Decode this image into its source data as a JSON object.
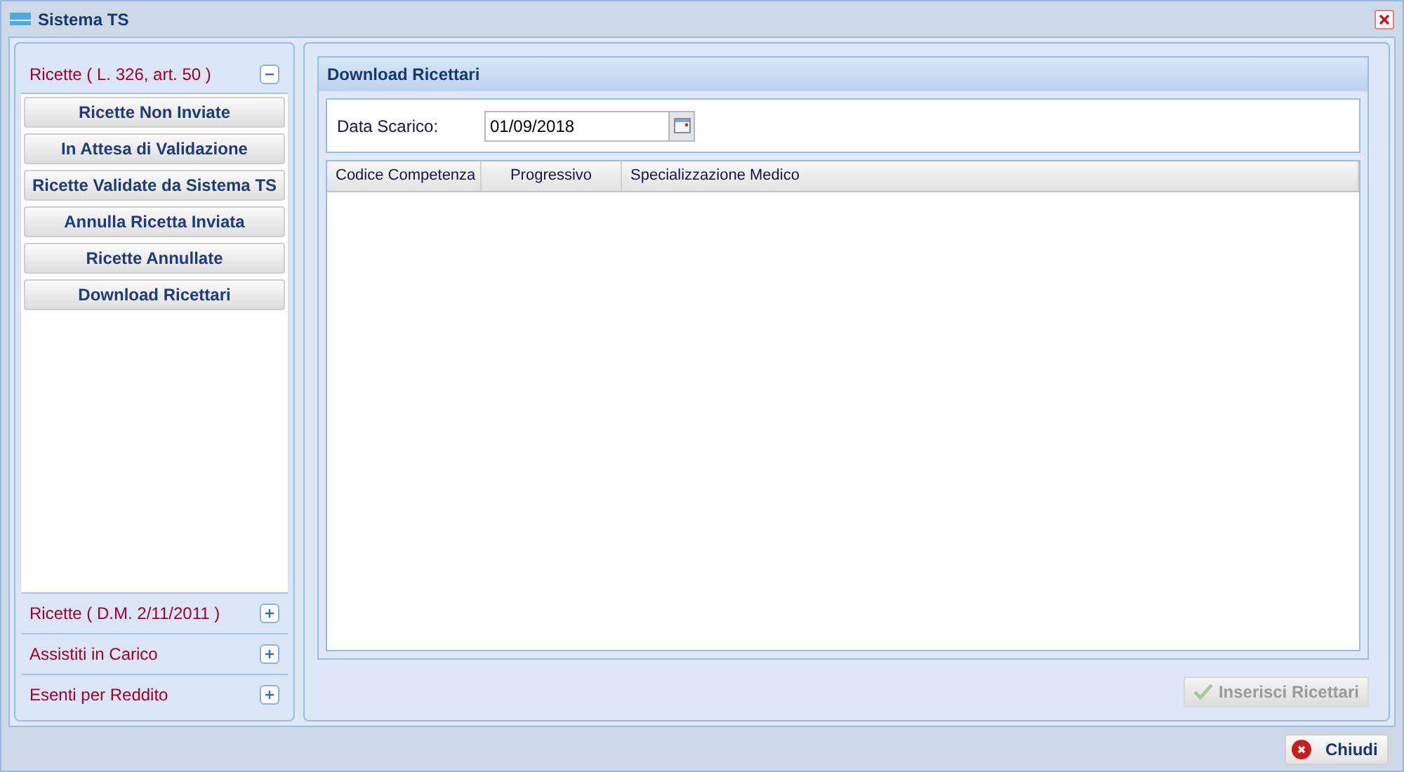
{
  "window": {
    "title": "Sistema TS"
  },
  "sidebar": {
    "sections": [
      {
        "title": "Ricette ( L. 326, art. 50 )",
        "expanded": true,
        "items": [
          "Ricette Non Inviate",
          "In Attesa di Validazione",
          "Ricette Validate da Sistema TS",
          "Annulla Ricetta Inviata",
          "Ricette Annullate",
          "Download Ricettari"
        ]
      },
      {
        "title": "Ricette ( D.M. 2/11/2011 )",
        "expanded": false
      },
      {
        "title": "Assistiti in Carico",
        "expanded": false
      },
      {
        "title": "Esenti per Reddito",
        "expanded": false
      }
    ]
  },
  "panel": {
    "title": "Download Ricettari",
    "field": {
      "label": "Data Scarico:",
      "value": "01/09/2018"
    },
    "table": {
      "columns": [
        "Codice Competenza",
        "Progressivo",
        "Specializzazione Medico"
      ]
    },
    "action": {
      "label": "Inserisci Ricettari",
      "disabled": true
    }
  },
  "footer": {
    "buttons": [
      "Chiudi"
    ]
  }
}
